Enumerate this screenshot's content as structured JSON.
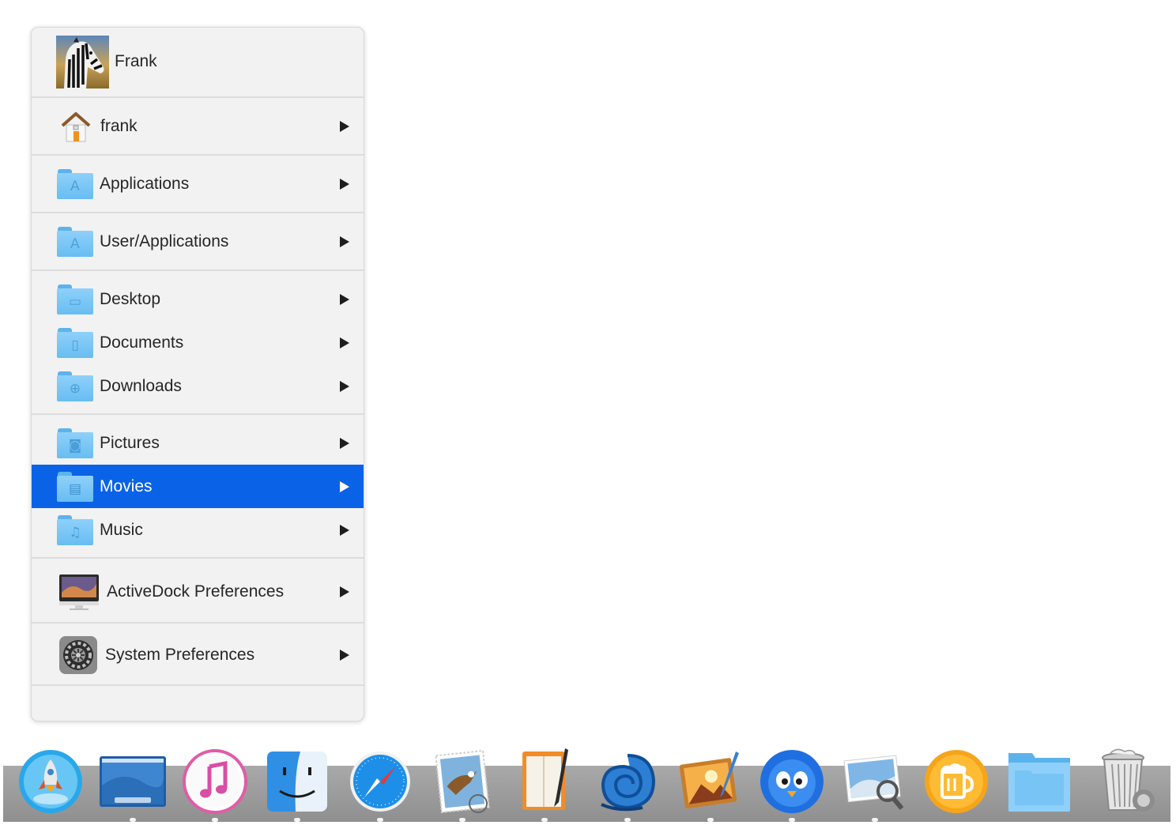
{
  "menu": {
    "user_name": "Frank",
    "items": [
      {
        "label": "frank"
      },
      {
        "label": "Applications"
      },
      {
        "label": "User/Applications"
      },
      {
        "label": "Desktop"
      },
      {
        "label": "Documents"
      },
      {
        "label": "Downloads"
      },
      {
        "label": "Pictures"
      },
      {
        "label": "Movies"
      },
      {
        "label": "Music"
      },
      {
        "label": "ActiveDock Preferences"
      },
      {
        "label": "System Preferences"
      }
    ],
    "selected_item": "Movies",
    "selection_color": "#0a63e6"
  },
  "dock": {
    "icons": [
      "launchpad-icon",
      "desktop-icon",
      "itunes-icon",
      "finder-icon",
      "safari-icon",
      "mail-icon",
      "notes-icon",
      "nautilus-app-icon",
      "photo-editor-icon",
      "tweetbot-icon",
      "preview-icon",
      "beer-app-icon",
      "folder-icon",
      "trash-icon"
    ]
  }
}
